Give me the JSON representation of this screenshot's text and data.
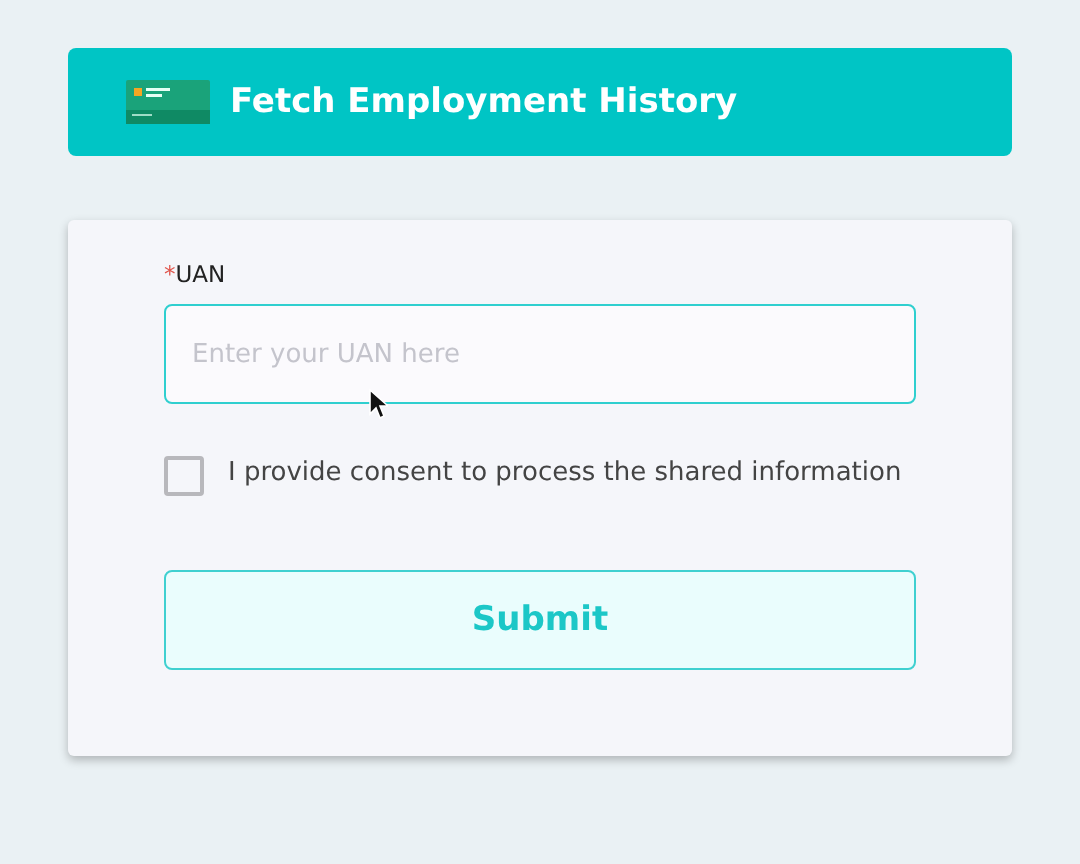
{
  "header": {
    "title": "Fetch Employment History"
  },
  "form": {
    "field": {
      "label": "UAN",
      "required": true,
      "marker": "*",
      "placeholder": "Enter your UAN here"
    },
    "consent": {
      "label": "I provide consent to process the shared information",
      "checked": false
    },
    "submit": {
      "label": "Submit"
    }
  }
}
